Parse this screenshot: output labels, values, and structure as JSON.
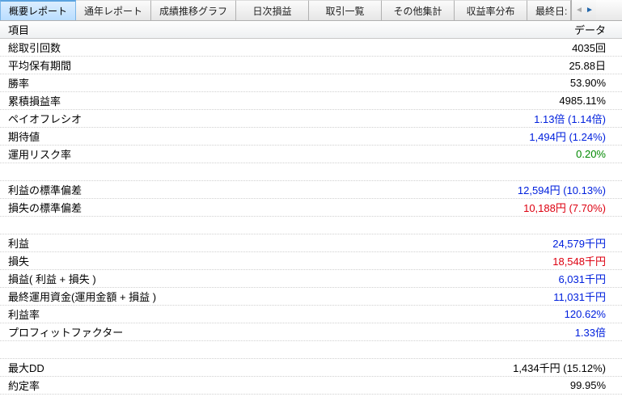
{
  "tabs": [
    {
      "label": "概要レポート",
      "active": true
    },
    {
      "label": "通年レポート"
    },
    {
      "label": "成績推移グラフ"
    },
    {
      "label": "日次損益"
    },
    {
      "label": "取引一覧"
    },
    {
      "label": "その他集計"
    },
    {
      "label": "収益率分布"
    },
    {
      "label": "最終日:",
      "partial": true
    }
  ],
  "header": {
    "item_label": "項目",
    "data_label": "データ"
  },
  "rows": [
    {
      "label": "総取引回数",
      "value": "4035回",
      "color": "black"
    },
    {
      "label": "平均保有期間",
      "value": "25.88日",
      "color": "black"
    },
    {
      "label": "勝率",
      "value": "53.90%",
      "color": "black"
    },
    {
      "label": "累積損益率",
      "value": "4985.11%",
      "color": "black"
    },
    {
      "label": "ペイオフレシオ",
      "value": "1.13倍 (1.14倍)",
      "color": "blue"
    },
    {
      "label": "期待値",
      "value": "1,494円 (1.24%)",
      "color": "blue"
    },
    {
      "label": "運用リスク率",
      "value": "0.20%",
      "color": "green"
    },
    {
      "spacer": true
    },
    {
      "label": "利益の標準偏差",
      "value": "12,594円 (10.13%)",
      "color": "blue"
    },
    {
      "label": "損失の標準偏差",
      "value": "10,188円 (7.70%)",
      "color": "red"
    },
    {
      "spacer": true
    },
    {
      "label": "利益",
      "value": "24,579千円",
      "color": "blue"
    },
    {
      "label": "損失",
      "value": "18,548千円",
      "color": "red"
    },
    {
      "label": "損益( 利益 + 損失 )",
      "value": "6,031千円",
      "color": "blue"
    },
    {
      "label": "最終運用資金(運用金額 + 損益 )",
      "value": "11,031千円",
      "color": "blue"
    },
    {
      "label": "利益率",
      "value": "120.62%",
      "color": "blue"
    },
    {
      "label": "プロフィットファクター",
      "value": "1.33倍",
      "color": "blue"
    },
    {
      "spacer": true
    },
    {
      "label": "最大DD",
      "value": "1,434千円 (15.12%)",
      "color": "black"
    },
    {
      "label": "約定率",
      "value": "99.95%",
      "color": "black"
    }
  ]
}
